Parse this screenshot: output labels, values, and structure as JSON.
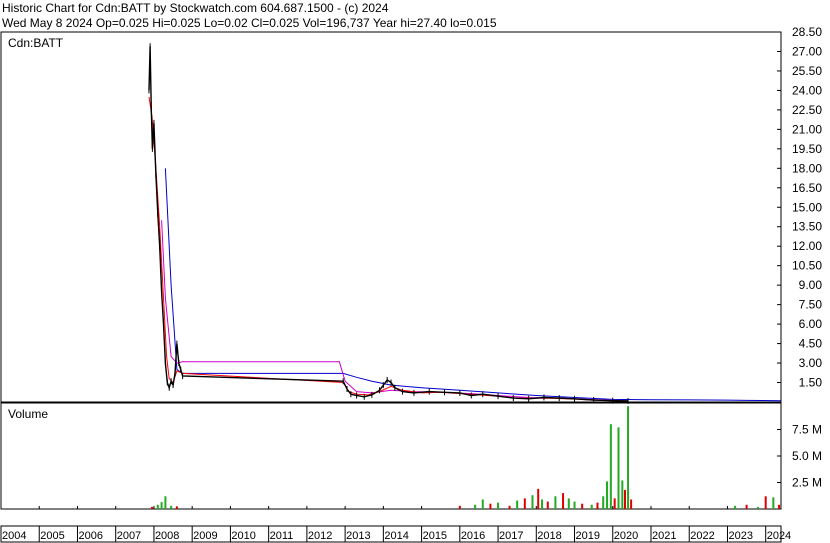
{
  "header": {
    "line1": "Historic Chart for Cdn:BATT by Stockwatch.com 604.687.1500 - (c) 2024",
    "line2": "Wed May  8 2024   Op=0.025   Hi=0.025   Lo=0.02   Cl=0.025   Vol=196,737   Year hi=27.40   lo=0.015"
  },
  "colors": {
    "price": "#000000",
    "ma_short": "#ff0000",
    "ma_mid": "#cc00cc",
    "ma_long": "#0000cc",
    "vol_up": "#22aa22",
    "vol_down": "#dd0000",
    "frame": "#000000",
    "grid": "#cccccc"
  },
  "chart_data": [
    {
      "type": "line",
      "title": "Cdn:BATT",
      "ylim": [
        0,
        28.5
      ],
      "y_ticks": [
        1.5,
        3.0,
        4.5,
        6.0,
        7.5,
        9.0,
        10.5,
        12.0,
        13.5,
        15.0,
        16.5,
        18.0,
        19.5,
        21.0,
        22.5,
        24.0,
        25.5,
        27.0,
        28.5
      ],
      "y_tick_labels": [
        "1.50",
        "3.00",
        "4.50",
        "6.00",
        "7.50",
        "9.00",
        "10.50",
        "12.00",
        "13.50",
        "15.00",
        "16.50",
        "18.00",
        "19.50",
        "21.00",
        "22.50",
        "24.00",
        "25.50",
        "27.00",
        "28.50"
      ],
      "xlim": [
        2004.0,
        2024.4
      ],
      "x_ticks": [
        2004,
        2005,
        2006,
        2007,
        2008,
        2009,
        2010,
        2011,
        2012,
        2013,
        2014,
        2015,
        2016,
        2017,
        2018,
        2019,
        2020,
        2021,
        2022,
        2023,
        2024
      ],
      "series": [
        {
          "key": "price",
          "x": [
            2007.87,
            2007.9,
            2007.93,
            2007.96,
            2008.0,
            2008.05,
            2008.1,
            2008.15,
            2008.2,
            2008.25,
            2008.3,
            2008.35,
            2008.4,
            2008.45,
            2008.5,
            2008.55,
            2008.6,
            2008.65,
            2008.7,
            2008.75,
            2012.95,
            2013.05,
            2013.15,
            2013.3,
            2013.5,
            2013.7,
            2013.9,
            2014.0,
            2014.1,
            2014.2,
            2014.3,
            2014.5,
            2014.8,
            2015.2,
            2015.6,
            2016.0,
            2016.3,
            2016.6,
            2017.0,
            2017.4,
            2017.8,
            2018.2,
            2018.6,
            2019.0,
            2019.5,
            2020.0,
            2020.4
          ],
          "values": [
            24.0,
            27.4,
            22.5,
            19.5,
            21.5,
            17.5,
            14.5,
            12.0,
            8.5,
            6.0,
            3.0,
            1.5,
            1.1,
            1.6,
            1.3,
            2.2,
            4.5,
            3.0,
            2.5,
            2.0,
            1.6,
            1.0,
            0.6,
            0.5,
            0.4,
            0.55,
            0.9,
            1.3,
            1.7,
            1.5,
            1.1,
            0.8,
            0.7,
            0.8,
            0.75,
            0.7,
            0.5,
            0.6,
            0.45,
            0.3,
            0.25,
            0.35,
            0.3,
            0.25,
            0.15,
            0.1,
            0.08
          ]
        },
        {
          "key": "ma_short",
          "x": [
            2007.87,
            2007.95,
            2008.05,
            2008.15,
            2008.25,
            2008.33,
            2008.4,
            2008.5,
            2008.6,
            2008.75,
            2012.95,
            2013.1,
            2013.3,
            2013.6,
            2013.9,
            2014.2,
            2014.5,
            2015.0,
            2015.5,
            2016.0,
            2016.5,
            2017.0,
            2017.5,
            2018.0,
            2018.5,
            2019.0,
            2019.5,
            2020.0,
            2020.4
          ],
          "values": [
            23.5,
            22.0,
            18.0,
            13.5,
            8.0,
            3.5,
            1.8,
            1.5,
            2.4,
            2.2,
            1.5,
            0.8,
            0.6,
            0.55,
            0.8,
            1.2,
            0.9,
            0.7,
            0.75,
            0.65,
            0.55,
            0.45,
            0.3,
            0.3,
            0.28,
            0.22,
            0.15,
            0.1,
            0.08
          ]
        },
        {
          "key": "ma_mid",
          "x": [
            2008.2,
            2008.3,
            2008.45,
            2008.6,
            2008.75,
            2012.85,
            2013.0,
            2013.3,
            2013.7,
            2014.2,
            2014.8,
            2015.5,
            2016.3,
            2017.0,
            2017.8,
            2018.5,
            2019.2,
            2020.0,
            2020.4
          ],
          "values": [
            14.0,
            8.0,
            3.5,
            3.0,
            3.1,
            3.1,
            1.6,
            0.8,
            0.7,
            0.9,
            0.8,
            0.75,
            0.65,
            0.5,
            0.35,
            0.3,
            0.22,
            0.12,
            0.1
          ]
        },
        {
          "key": "ma_long",
          "x": [
            2008.3,
            2008.45,
            2008.6,
            2008.75,
            2012.95,
            2013.3,
            2013.7,
            2014.2,
            2015.0,
            2016.0,
            2017.0,
            2018.0,
            2019.0,
            2020.0,
            2021.0,
            2022.0,
            2023.0,
            2023.5,
            2024.4
          ],
          "values": [
            18.0,
            9.0,
            2.5,
            2.2,
            2.2,
            1.9,
            1.6,
            1.3,
            1.1,
            0.9,
            0.7,
            0.5,
            0.35,
            0.2,
            0.18,
            0.16,
            0.15,
            0.12,
            0.1
          ]
        }
      ]
    },
    {
      "type": "bar",
      "title": "Volume",
      "ylim": [
        0,
        10000000
      ],
      "y_ticks": [
        2500000,
        5000000,
        7500000
      ],
      "y_tick_labels": [
        "2.5 M",
        "5.0 M",
        "7.5 M"
      ],
      "xlim": [
        2004.0,
        2024.4
      ],
      "bars": [
        {
          "x": 2007.95,
          "value": 200000,
          "dir": "down"
        },
        {
          "x": 2008.1,
          "value": 400000,
          "dir": "up"
        },
        {
          "x": 2008.2,
          "value": 650000,
          "dir": "up"
        },
        {
          "x": 2008.3,
          "value": 1200000,
          "dir": "up"
        },
        {
          "x": 2008.45,
          "value": 300000,
          "dir": "up"
        },
        {
          "x": 2008.6,
          "value": 250000,
          "dir": "down"
        },
        {
          "x": 2016.0,
          "value": 300000,
          "dir": "down"
        },
        {
          "x": 2016.4,
          "value": 400000,
          "dir": "up"
        },
        {
          "x": 2016.6,
          "value": 900000,
          "dir": "up"
        },
        {
          "x": 2016.8,
          "value": 500000,
          "dir": "down"
        },
        {
          "x": 2017.0,
          "value": 600000,
          "dir": "up"
        },
        {
          "x": 2017.3,
          "value": 300000,
          "dir": "down"
        },
        {
          "x": 2017.5,
          "value": 800000,
          "dir": "up"
        },
        {
          "x": 2017.7,
          "value": 1000000,
          "dir": "down"
        },
        {
          "x": 2017.9,
          "value": 1300000,
          "dir": "up"
        },
        {
          "x": 2018.05,
          "value": 1900000,
          "dir": "down"
        },
        {
          "x": 2018.15,
          "value": 900000,
          "dir": "up"
        },
        {
          "x": 2018.3,
          "value": 700000,
          "dir": "down"
        },
        {
          "x": 2018.5,
          "value": 1200000,
          "dir": "up"
        },
        {
          "x": 2018.7,
          "value": 1500000,
          "dir": "down"
        },
        {
          "x": 2018.85,
          "value": 1000000,
          "dir": "up"
        },
        {
          "x": 2019.0,
          "value": 700000,
          "dir": "up"
        },
        {
          "x": 2019.2,
          "value": 500000,
          "dir": "down"
        },
        {
          "x": 2019.45,
          "value": 400000,
          "dir": "up"
        },
        {
          "x": 2019.6,
          "value": 600000,
          "dir": "down"
        },
        {
          "x": 2019.75,
          "value": 1200000,
          "dir": "up"
        },
        {
          "x": 2019.85,
          "value": 2600000,
          "dir": "up"
        },
        {
          "x": 2019.95,
          "value": 8000000,
          "dir": "up"
        },
        {
          "x": 2020.05,
          "value": 1000000,
          "dir": "down"
        },
        {
          "x": 2020.15,
          "value": 7700000,
          "dir": "up"
        },
        {
          "x": 2020.25,
          "value": 2700000,
          "dir": "up"
        },
        {
          "x": 2020.32,
          "value": 1800000,
          "dir": "down"
        },
        {
          "x": 2020.4,
          "value": 9700000,
          "dir": "up"
        },
        {
          "x": 2020.48,
          "value": 900000,
          "dir": "down"
        },
        {
          "x": 2023.2,
          "value": 300000,
          "dir": "up"
        },
        {
          "x": 2023.5,
          "value": 400000,
          "dir": "down"
        },
        {
          "x": 2023.8,
          "value": 200000,
          "dir": "up"
        },
        {
          "x": 2024.0,
          "value": 1200000,
          "dir": "down"
        },
        {
          "x": 2024.2,
          "value": 1100000,
          "dir": "up"
        },
        {
          "x": 2024.35,
          "value": 400000,
          "dir": "down"
        }
      ]
    }
  ]
}
